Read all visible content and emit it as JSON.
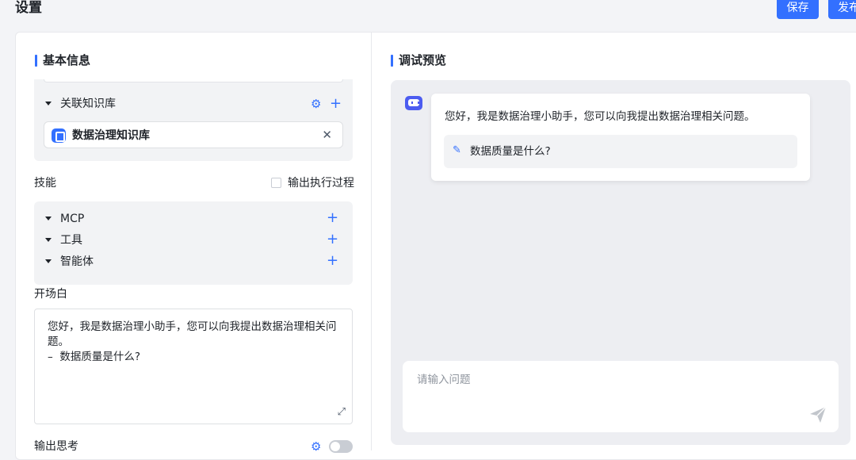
{
  "header": {
    "title": "设置",
    "save_label": "保存",
    "publish_label": "发布"
  },
  "left": {
    "section_title": "基本信息",
    "knowledge": {
      "label": "关联知识库",
      "item_name": "数据治理知识库",
      "close_glyph": "✕"
    },
    "skills": {
      "label": "技能",
      "show_process_label": "输出执行过程",
      "items": [
        {
          "label": "MCP"
        },
        {
          "label": "工具"
        },
        {
          "label": "智能体"
        }
      ]
    },
    "opening": {
      "label": "开场白",
      "text": "您好，我是数据治理小助手，您可以向我提出数据治理相关问题。\n–  数据质量是什么?"
    },
    "output_thinking": {
      "label": "输出思考",
      "enabled": false
    }
  },
  "right": {
    "section_title": "调试预览",
    "bot_message": "您好，我是数据治理小助手，您可以向我提出数据治理相关问题。",
    "suggestion": "数据质量是什么?",
    "input_placeholder": "请输入问题"
  },
  "icons": {
    "plus": "+",
    "gear": "⚙",
    "edit": "✎",
    "expand": "⤢",
    "send": "send-icon"
  },
  "colors": {
    "accent": "#3370ff",
    "bot": "#4c5cf0"
  }
}
